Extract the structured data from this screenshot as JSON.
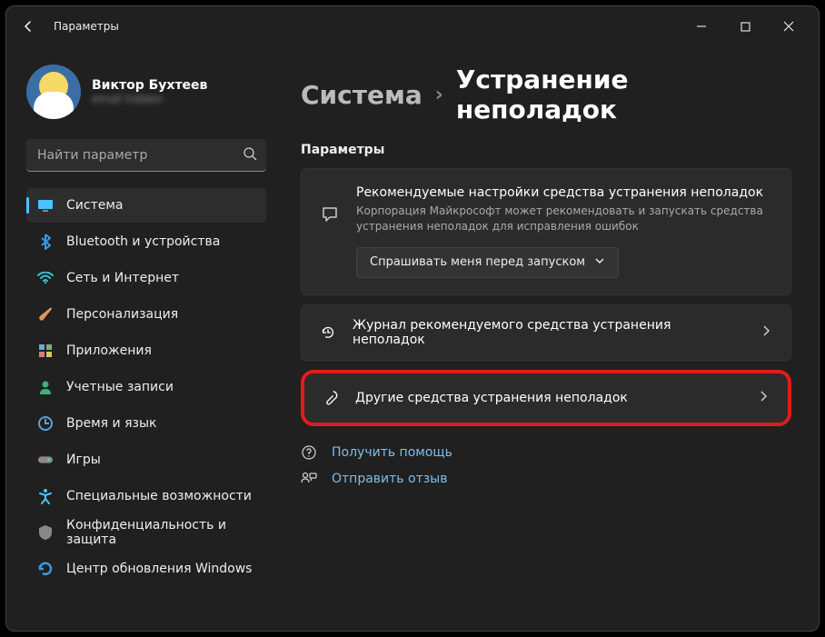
{
  "titlebar": {
    "title": "Параметры"
  },
  "profile": {
    "name": "Виктор Бухтеев",
    "email": "email hidden"
  },
  "search": {
    "placeholder": "Найти параметр"
  },
  "sidebar": {
    "items": [
      {
        "label": "Система",
        "icon": "monitor",
        "active": true
      },
      {
        "label": "Bluetooth и устройства",
        "icon": "bluetooth"
      },
      {
        "label": "Сеть и Интернет",
        "icon": "wifi"
      },
      {
        "label": "Персонализация",
        "icon": "brush"
      },
      {
        "label": "Приложения",
        "icon": "apps"
      },
      {
        "label": "Учетные записи",
        "icon": "person"
      },
      {
        "label": "Время и язык",
        "icon": "clock-globe"
      },
      {
        "label": "Игры",
        "icon": "gamepad"
      },
      {
        "label": "Специальные возможности",
        "icon": "accessibility"
      },
      {
        "label": "Конфиденциальность и защита",
        "icon": "shield"
      },
      {
        "label": "Центр обновления Windows",
        "icon": "update"
      }
    ]
  },
  "breadcrumb": {
    "parent": "Система",
    "current": "Устранение неполадок"
  },
  "main": {
    "section_label": "Параметры",
    "recommended": {
      "title": "Рекомендуемые настройки средства устранения неполадок",
      "desc": "Корпорация Майкрософт может рекомендовать и запускать средства устранения неполадок для исправления ошибок",
      "dropdown_value": "Спрашивать меня перед запуском"
    },
    "rows": [
      {
        "label": "Журнал рекомендуемого средства устранения неполадок",
        "icon": "history",
        "highlight": false
      },
      {
        "label": "Другие средства устранения неполадок",
        "icon": "wrench",
        "highlight": true
      }
    ],
    "links": [
      {
        "label": "Получить помощь",
        "icon": "help"
      },
      {
        "label": "Отправить отзыв",
        "icon": "feedback"
      }
    ]
  }
}
